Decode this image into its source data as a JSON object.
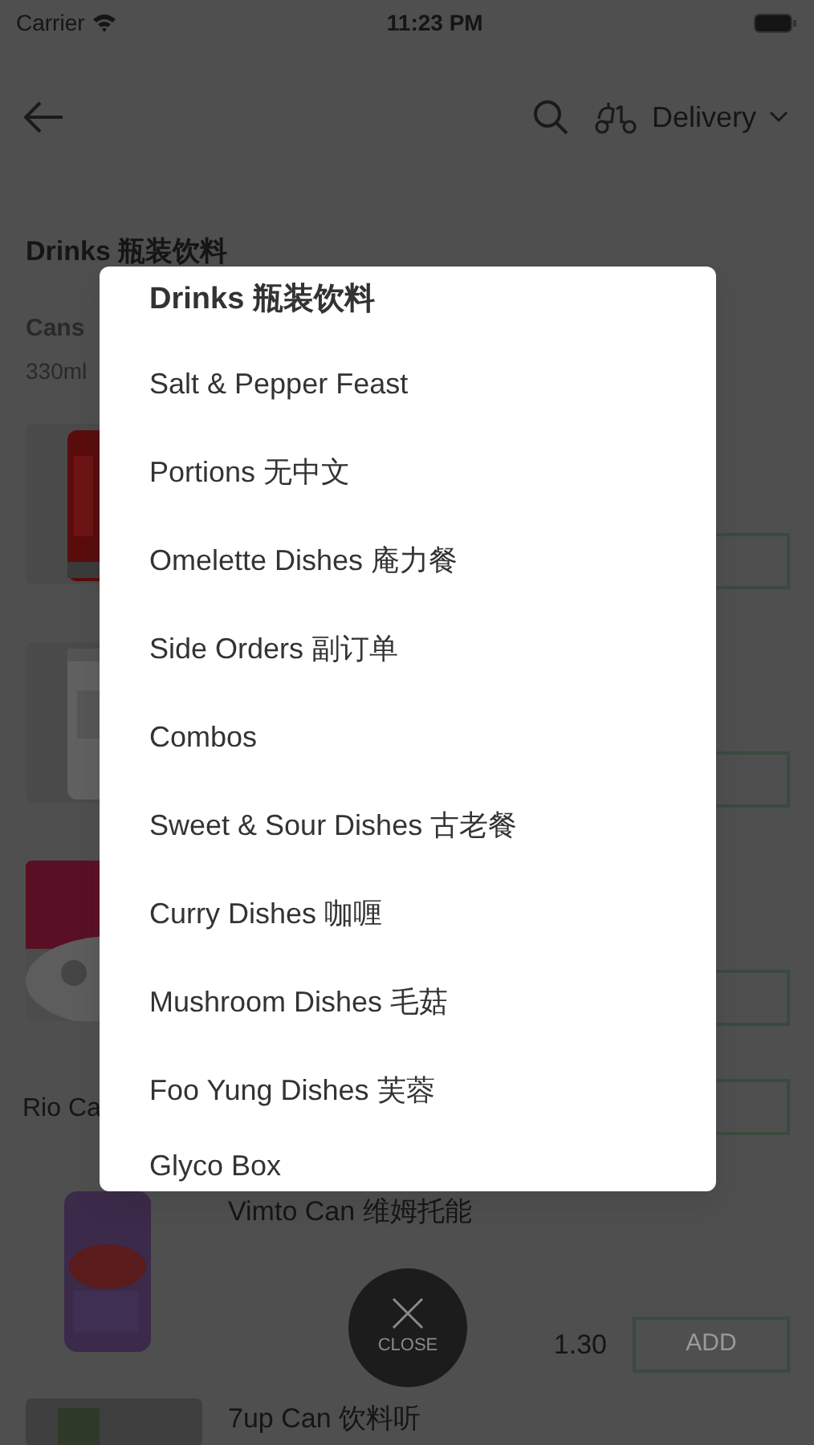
{
  "status_bar": {
    "carrier": "Carrier",
    "time": "11:23 PM"
  },
  "header": {
    "mode": "Delivery"
  },
  "section": {
    "title": "Drinks 瓶装饮料",
    "subtitle": "Cans",
    "note": "330ml"
  },
  "products": [
    {
      "kind": "image-row"
    },
    {
      "kind": "image-row"
    },
    {
      "kind": "image-row"
    },
    {
      "kind": "text-row",
      "name": "Rio Ca"
    },
    {
      "kind": "full",
      "name": "Vimto Can 维姆托能",
      "price": "1.30",
      "button": "ADD"
    },
    {
      "kind": "top",
      "name": "7up Can 饮料听"
    }
  ],
  "menu": {
    "title": "Drinks 瓶装饮料",
    "items": [
      "Salt & Pepper Feast",
      "Portions 无中文",
      "Omelette Dishes 庵力餐",
      "Side Orders 副订单",
      "Combos",
      "Sweet & Sour Dishes 古老餐",
      "Curry Dishes 咖喱",
      "Mushroom Dishes 毛菇",
      "Foo Yung Dishes 芙蓉",
      "Glyco Box"
    ]
  },
  "close": {
    "label": "CLOSE"
  }
}
